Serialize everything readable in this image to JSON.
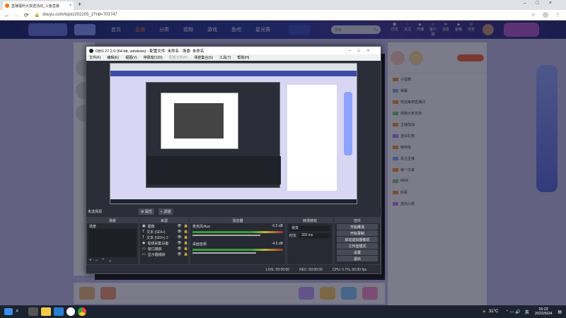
{
  "browser": {
    "tab_title": "直播福利大放送活动_斗鱼直播",
    "url": "douyu.com/topic/202205_2?rid=703747"
  },
  "site": {
    "nav": [
      "首页",
      "直播",
      "分类",
      "视频",
      "游戏",
      "鱼吧",
      "星光赛",
      "领取"
    ],
    "search_placeholder": "搜索",
    "header_icons": [
      "历史",
      "关注",
      "开播",
      "客户端",
      "消息",
      "鱼粮",
      "任务"
    ]
  },
  "obs": {
    "title": "OBS 27.2.0 (64-bit, windows) - 配置文件: 未命名 - 场景: 未命名",
    "menu": [
      "文件(F)",
      "编辑(E)",
      "视图(V)",
      "停靠窗口(D)",
      "配置文件(P)",
      "场景集合(S)",
      "工具(T)",
      "帮助(H)"
    ],
    "no_source": "未选择源",
    "props_btn": "属性",
    "filter_btn": "滤镜",
    "panels": {
      "scenes": "场景",
      "sources": "来源",
      "mixer": "混音器",
      "transitions": "转场特效",
      "controls": "控件"
    },
    "scene_items": [
      "场景"
    ],
    "sources": [
      {
        "icon": "image-icon",
        "name": "图像"
      },
      {
        "icon": "text-icon",
        "name": "文本 (GDI+)"
      },
      {
        "icon": "text-icon",
        "name": "文本 (GDI+) 2"
      },
      {
        "icon": "camera-icon",
        "name": "视频采集设备"
      },
      {
        "icon": "monitor-icon",
        "name": "窗口捕获"
      },
      {
        "icon": "monitor-icon",
        "name": "显示器捕获"
      }
    ],
    "mixer": [
      {
        "name": "麦克风/Aux",
        "db": "-5.5 dB"
      },
      {
        "name": "桌面音频",
        "db": "-4.6 dB"
      }
    ],
    "transition": "渐变",
    "duration_label": "时长",
    "duration": "300 ms",
    "controls": [
      "开始推流",
      "开始录制",
      "启动虚拟摄像机",
      "工作室模式",
      "设置",
      "退出"
    ],
    "status": {
      "live": "LIVE: 00:00:00",
      "rec": "REC: 00:00:00",
      "cpu": "CPU: 0.7%, 60.00 fps"
    }
  },
  "chat": {
    "messages": [
      "小蛋糕",
      "弹幕",
      "欢迎来到直播间",
      "感谢大家支持",
      "主播加油",
      "送出礼物",
      "哈哈哈",
      "关注主播",
      "第一次来",
      "6666",
      "好看",
      "送出火箭"
    ]
  },
  "taskbar": {
    "weather": "31°C",
    "time": "16:22",
    "date": "2022/6/24",
    "lang": "英"
  }
}
